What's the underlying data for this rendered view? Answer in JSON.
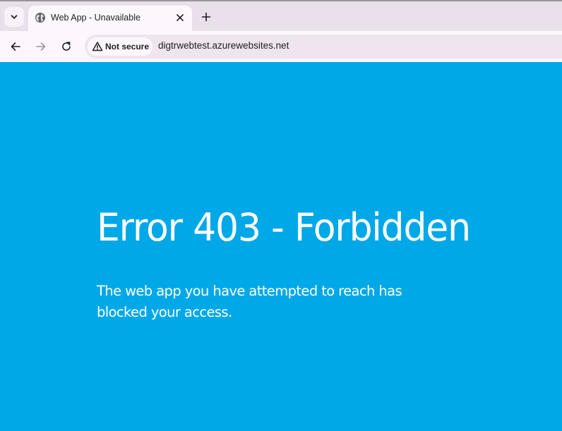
{
  "browser": {
    "tab": {
      "title": "Web App - Unavailable"
    },
    "security": {
      "label": "Not secure"
    },
    "address": {
      "url": "digtrwebtest.azurewebsites.net"
    }
  },
  "page": {
    "title": "Error 403 - Forbidden",
    "message": "The web app you have attempted to reach has blocked your access."
  },
  "icons": {
    "tab_list": "chevron-down-icon",
    "favicon": "globe-icon",
    "tab_close": "close-icon",
    "new_tab": "plus-icon",
    "back": "arrow-left-icon",
    "forward": "arrow-right-icon",
    "reload": "reload-icon",
    "security": "warning-triangle-icon"
  },
  "colors": {
    "page_background": "#00a8e8",
    "browser_frame": "#e9e0ec",
    "toolbar": "#fdf7fd",
    "text_on_page": "#ffffff"
  }
}
